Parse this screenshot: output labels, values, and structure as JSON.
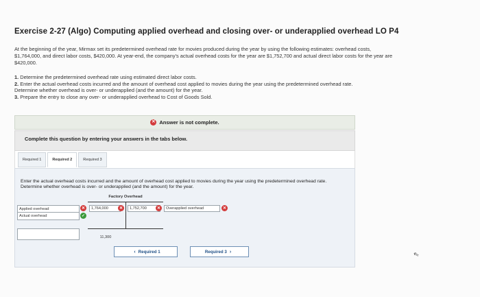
{
  "exercise": {
    "title": "Exercise 2-27 (Algo) Computing applied overhead and closing over- or underapplied overhead LO P4",
    "intro": "At the beginning of the year, Mirmax set its predetermined overhead rate for movies produced during the year by using the following estimates: overhead costs, $1,764,000, and direct labor costs, $420,000. At year-end, the company's actual overhead costs for the year are $1,752,700 and actual direct labor costs for the year are $420,000.",
    "steps": [
      {
        "num": "1.",
        "text": " Determine the predetermined overhead rate using estimated direct labor costs."
      },
      {
        "num": "2.",
        "text": " Enter the actual overhead costs incurred and the amount of overhead cost applied to movies during the year using the predetermined overhead rate. Determine whether overhead is over- or underapplied (and the amount) for the year."
      },
      {
        "num": "3.",
        "text": " Prepare the entry to close any over- or underapplied overhead to Cost of Goods Sold."
      }
    ]
  },
  "status": {
    "answer_text": "Answer is not complete.",
    "complete_text": "Complete this question by entering your answers in the tabs below."
  },
  "tabs": [
    {
      "label": "Required 1"
    },
    {
      "label": "Required 2"
    },
    {
      "label": "Required 3"
    }
  ],
  "required2": {
    "instructions": "Enter the actual overhead costs incurred and the amount of overhead cost applied to movies during the year using the predetermined overhead rate. Determine whether overhead is over- or underapplied (and the amount) for the year.",
    "t_account_title": "Factory Overhead",
    "row_labels": [
      "Applied overhead",
      "Actual overhead"
    ],
    "debit_value": "1,764,000",
    "credit_value": "1,752,700",
    "over_under_label": "Overapplied overhead",
    "balance_value": "11,300"
  },
  "nav": {
    "prev_label": "Required 1",
    "next_label": "Required 3"
  }
}
